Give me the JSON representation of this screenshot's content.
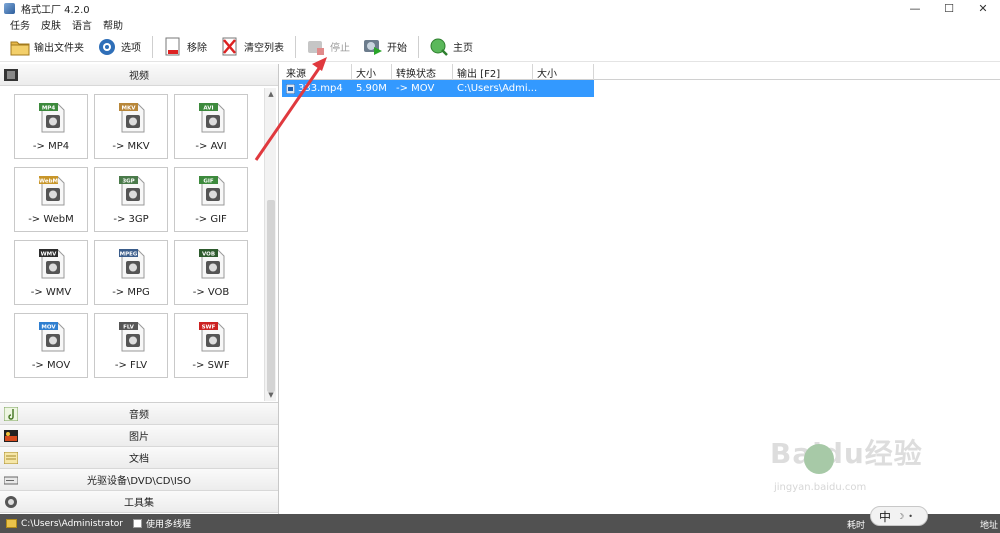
{
  "window": {
    "title": "格式工厂 4.2.0",
    "minimize": "—",
    "maximize": "☐",
    "close": "✕"
  },
  "menu": [
    "任务",
    "皮肤",
    "语言",
    "帮助"
  ],
  "toolbar": {
    "output_folder": "输出文件夹",
    "options": "选项",
    "remove": "移除",
    "clear_list": "清空列表",
    "stop": "停止",
    "start": "开始",
    "home": "主页"
  },
  "categories": {
    "video": "视频",
    "audio": "音频",
    "image": "图片",
    "document": "文档",
    "rom": "光驱设备\\DVD\\CD\\ISO",
    "tools": "工具集"
  },
  "formats": [
    {
      "label": "-> MP4",
      "badge": "MP4"
    },
    {
      "label": "-> MKV",
      "badge": "MKV"
    },
    {
      "label": "-> AVI",
      "badge": "AVI"
    },
    {
      "label": "-> WebM",
      "badge": "WebM"
    },
    {
      "label": "-> 3GP",
      "badge": "3GP"
    },
    {
      "label": "-> GIF",
      "badge": "GIF"
    },
    {
      "label": "-> WMV",
      "badge": "WMV"
    },
    {
      "label": "-> MPG",
      "badge": "MPEG"
    },
    {
      "label": "-> VOB",
      "badge": "VOB"
    },
    {
      "label": "-> MOV",
      "badge": "MOV"
    },
    {
      "label": "-> FLV",
      "badge": "FLV"
    },
    {
      "label": "-> SWF",
      "badge": "SWF"
    }
  ],
  "table": {
    "headers": [
      "来源",
      "大小",
      "转换状态",
      "输出 [F2]",
      "大小"
    ],
    "rows": [
      {
        "source": "333.mp4",
        "size": "5.90M",
        "status": "-> MOV",
        "output": "C:\\Users\\Admi...",
        "out_size": ""
      }
    ]
  },
  "status": {
    "path": "C:\\Users\\Administrator",
    "multithread": "使用多线程",
    "elapsed": "耗时",
    "right": "地址"
  },
  "ime": {
    "lang": "中"
  },
  "watermark": {
    "main": "Baidu经验",
    "sub": "jingyan.baidu.com"
  },
  "colors": {
    "selection": "#3399ff",
    "statusbar": "#515151",
    "arrow": "#e0393e"
  }
}
